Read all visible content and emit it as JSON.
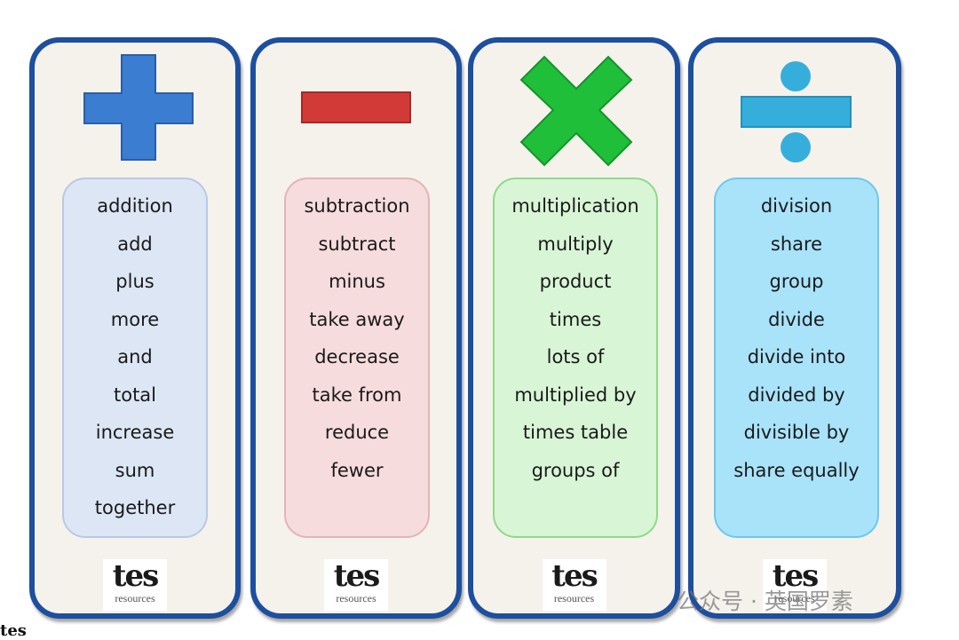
{
  "cards": [
    {
      "operation": "plus-icon",
      "color": "#3b7dd0",
      "words": [
        "addition",
        "add",
        "plus",
        "more",
        "and",
        "total",
        "increase",
        "sum",
        "together"
      ],
      "logo": "tes",
      "logo_sub": "resources"
    },
    {
      "operation": "minus-icon",
      "color": "#d23a38",
      "words": [
        "subtraction",
        "subtract",
        "minus",
        "take away",
        "decrease",
        "take from",
        "reduce",
        "fewer"
      ],
      "logo": "tes",
      "logo_sub": "resources"
    },
    {
      "operation": "multiply-icon",
      "color": "#1fbf3a",
      "words": [
        "multiplication",
        "multiply",
        "product",
        "times",
        "lots of",
        "multiplied by",
        "times table",
        "groups of"
      ],
      "logo": "tes",
      "logo_sub": "resources"
    },
    {
      "operation": "divide-icon",
      "color": "#36aedb",
      "words": [
        "division",
        "share",
        "group",
        "divide",
        "divide into",
        "divided by",
        "divisible by",
        "share equally"
      ],
      "logo": "tes",
      "logo_sub": "resources"
    }
  ],
  "watermark": "公众号 · 英国罗素",
  "corner_logo": "tes"
}
